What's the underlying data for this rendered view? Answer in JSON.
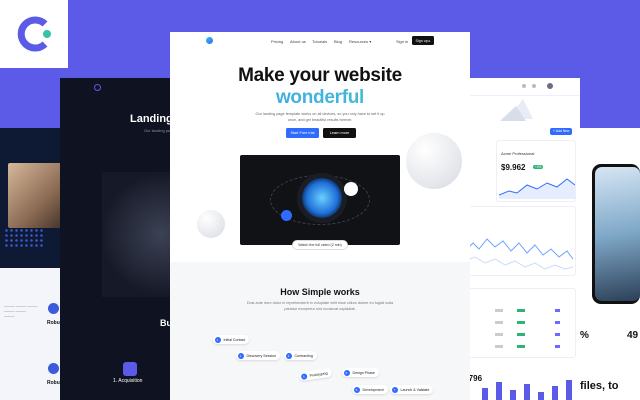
{
  "nav": {
    "links": [
      "Pricing",
      "About us",
      "Tutorials",
      "Blog",
      "Resources ▾"
    ],
    "signin": "Sign in",
    "signup": "Sign up ▸"
  },
  "hero": {
    "title_line1": "Make your website",
    "title_line2": "wonderful",
    "lead": "Our landing page template works on all devices, so you only have to set it up once, and get beautiful results forever.",
    "cta_primary": "Start Free trial",
    "cta_secondary": "Learn more",
    "watch": "Watch the full video (2 min)"
  },
  "how": {
    "title": "How Simple works",
    "desc": "Duis aute irure dolor in reprehenderit in voluptate velit esse cillum dolore eu fugiat nulla pariatur excepteur sint occaecat cupidatat.",
    "steps": [
      {
        "n": "1",
        "label": "Initial Contact"
      },
      {
        "n": "2",
        "label": "Discovery Session"
      },
      {
        "n": "3",
        "label": "Contracting"
      },
      {
        "n": "4",
        "label": "Prototyping"
      },
      {
        "n": "5",
        "label": "Design Phase"
      },
      {
        "n": "6",
        "label": "Development"
      },
      {
        "n": "7",
        "label": "Launch & Validate"
      }
    ]
  },
  "dark_page": {
    "title": "Landing",
    "sub": "Our landing page",
    "section": "Bu",
    "acquisition": "1. Acquisition"
  },
  "left_page": {
    "feat1": "Robu",
    "feat2": "Robu"
  },
  "dashboard": {
    "card_title": "Acme Professional",
    "price": "$9.962",
    "badge": "+2%",
    "price2": "4.796",
    "add_btn": "+ Add New"
  },
  "phone_page": {
    "stat1": "%",
    "stat2": "49",
    "footer": "files, to"
  },
  "colors": {
    "background": "#5b5be8",
    "accent_blue": "#2f6bff",
    "logo_teal": "#36c3a6",
    "logo_indigo": "#5b5be8"
  }
}
